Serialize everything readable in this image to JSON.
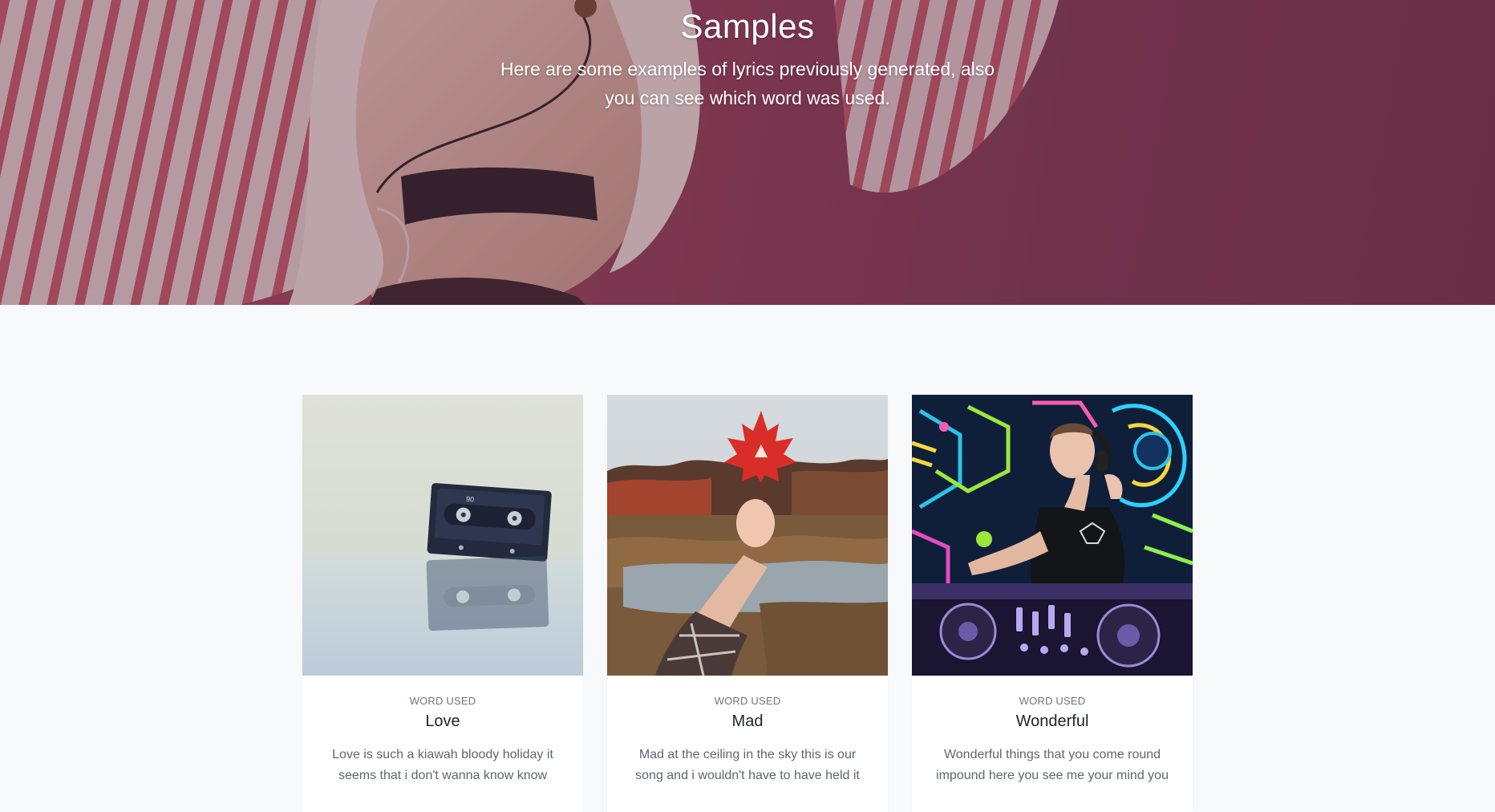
{
  "hero": {
    "title": "Samples",
    "subtitle": "Here are some examples of lyrics previously generated, also you can see which word was used."
  },
  "samples": [
    {
      "label": "WORD USED",
      "word": "Love",
      "lyrics": "Love is such a kiawah bloody holiday it seems that i don't wanna know know"
    },
    {
      "label": "WORD USED",
      "word": "Mad",
      "lyrics": "Mad at the ceiling in the sky this is our song and i wouldn't have to have held it"
    },
    {
      "label": "WORD USED",
      "word": "Wonderful",
      "lyrics": "Wonderful things that you come round impound here you see me your mind you"
    }
  ]
}
